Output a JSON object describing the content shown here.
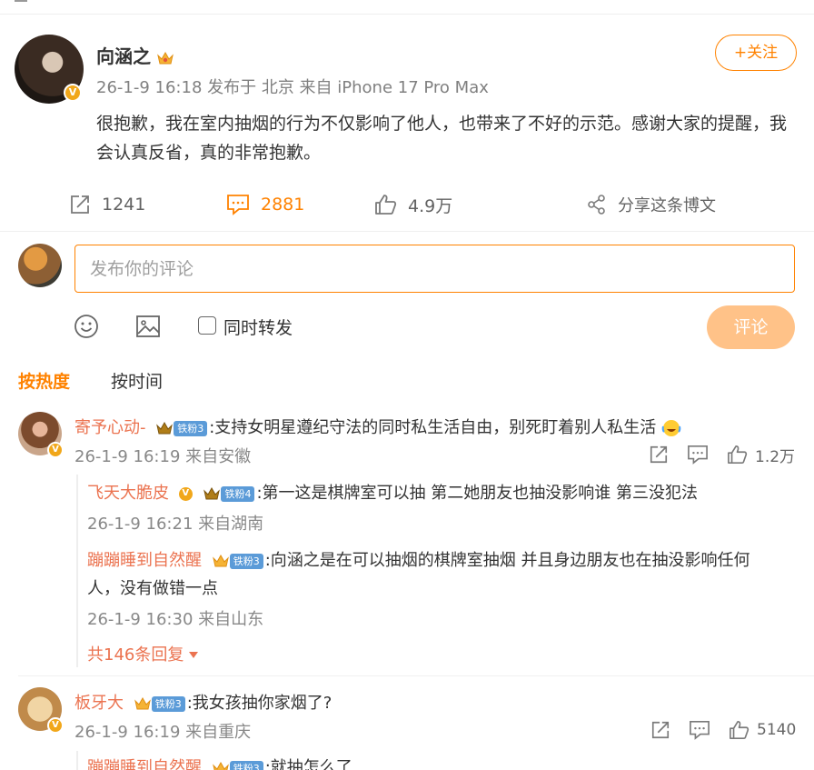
{
  "post": {
    "author": "向涵之",
    "meta": "26-1-9 16:18 发布于 北京 来自 iPhone 17 Pro Max",
    "follow_label": "+关注",
    "text": "很抱歉，我在室内抽烟的行为不仅影响了他人，也带来了不好的示范。感谢大家的提醒，我会认真反省，真的非常抱歉。",
    "repost_count": "1241",
    "comment_count": "2881",
    "like_count": "4.9万",
    "share_label": "分享这条博文"
  },
  "composer": {
    "placeholder": "发布你的评论",
    "repost_label": "同时转发",
    "submit_label": "评论"
  },
  "tabs": {
    "hot": "按热度",
    "time": "按时间"
  },
  "comments": [
    {
      "user": "寄予心动-",
      "fan": "铁粉3",
      "text": ":支持女明星遵纪守法的同时私生活自由，别死盯着别人私生活",
      "meta": "26-1-9 16:19 来自安徽",
      "likes": "1.2万",
      "replies": [
        {
          "user": "飞天大脆皮",
          "fan": "铁粉4",
          "text": ":第一这是棋牌室可以抽 第二她朋友也抽没影响谁 第三没犯法",
          "meta": "26-1-9 16:21 来自湖南"
        },
        {
          "user": "蹦蹦睡到自然醒",
          "fan": "铁粉3",
          "text": ":向涵之是在可以抽烟的棋牌室抽烟 并且身边朋友也在抽没影响任何",
          "text2": "人，没有做错一点",
          "meta": "26-1-9 16:30 来自山东"
        }
      ],
      "more_replies": "共146条回复"
    },
    {
      "user": "板牙大",
      "fan": "铁粉3",
      "text": ":我女孩抽你家烟了?",
      "meta": "26-1-9 16:19 来自重庆",
      "likes": "5140",
      "replies": [
        {
          "user": "蹦蹦睡到自然醒",
          "fan": "铁粉3",
          "text": ":就抽怎么了"
        }
      ]
    }
  ],
  "colors": {
    "accent": "#ff8200",
    "username": "#eb7350",
    "fan_badge": "#5b9bd8",
    "submit_disabled": "#ffc288"
  }
}
